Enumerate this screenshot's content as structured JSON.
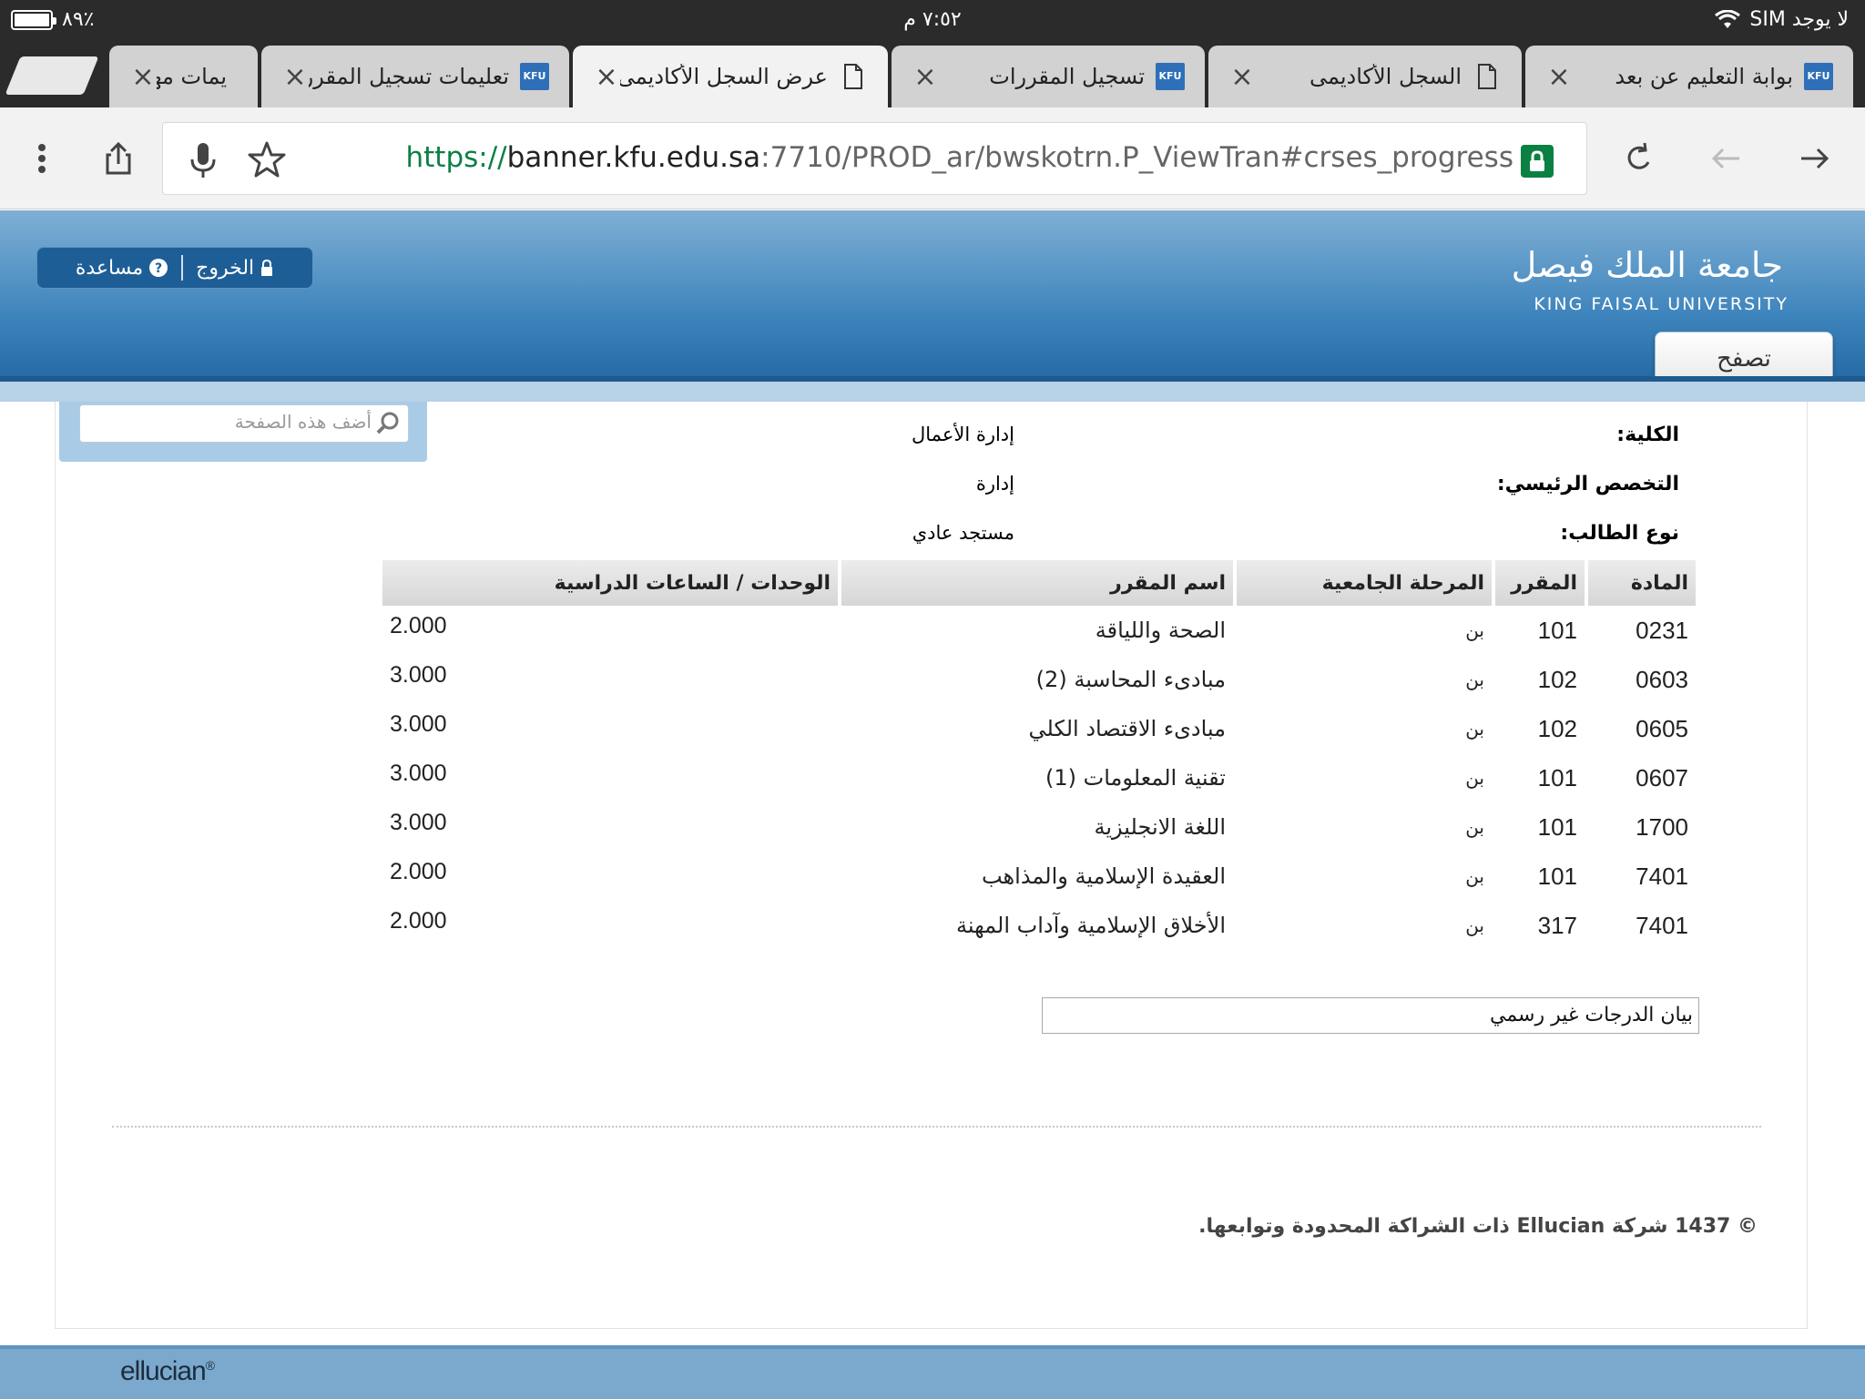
{
  "status_bar": {
    "battery_percent": 89,
    "battery_text": "٨٩٪",
    "time": "٧:٥٢ م",
    "carrier": "لا يوجد SIM"
  },
  "tabs": [
    {
      "title": "بوابة التعليم عن بعد",
      "icon": "kfu-logo",
      "active": false
    },
    {
      "title": "السجل الأكاديمى",
      "icon": "document-icon",
      "active": false
    },
    {
      "title": "تسجيل المقررات",
      "icon": "kfu-logo",
      "active": false
    },
    {
      "title": "عرض السجل الأكاديمى",
      "icon": "document-icon",
      "active": true
    },
    {
      "title": "تعليمات تسجيل المقررا",
      "icon": "kfu-logo",
      "active": false
    },
    {
      "title": "يمات مهـ",
      "icon": "",
      "active": false
    }
  ],
  "tab_logo_text": "KFU",
  "omnibox": {
    "scheme": "https://",
    "host": "banner.kfu.edu.sa",
    "path": ":7710/PROD_ar/bwskotrn.P_ViewTran#crses_progress"
  },
  "header": {
    "brand_ar": "جامعة الملك فيصل",
    "brand_en": "KING FAISAL UNIVERSITY",
    "logout_label": "الخروج",
    "help_label": "مساعدة",
    "browse_label": "تصفح"
  },
  "search": {
    "placeholder": "أضف هذه الصفحة"
  },
  "student_info": [
    {
      "label": "الكلية:",
      "value": "إدارة الأعمال"
    },
    {
      "label": "التخصص الرئيسي:",
      "value": "إدارة"
    },
    {
      "label": "نوع الطالب:",
      "value": "مستجد عادي"
    }
  ],
  "courses_table": {
    "headers": [
      "المادة",
      "المقرر",
      "المرحلة الجامعية",
      "اسم المقرر",
      "الوحدات / الساعات الدراسية"
    ],
    "rows": [
      {
        "subject": "0231",
        "course": "101",
        "level": "بن",
        "title": "الصحة واللياقة",
        "units": "2.000"
      },
      {
        "subject": "0603",
        "course": "102",
        "level": "بن",
        "title": "مبادىء المحاسبة (2)",
        "units": "3.000"
      },
      {
        "subject": "0605",
        "course": "102",
        "level": "بن",
        "title": "مبادىء الاقتصاد الكلي",
        "units": "3.000"
      },
      {
        "subject": "0607",
        "course": "101",
        "level": "بن",
        "title": "تقنية المعلومات (1)",
        "units": "3.000"
      },
      {
        "subject": "1700",
        "course": "101",
        "level": "بن",
        "title": "اللغة الانجليزية",
        "units": "3.000"
      },
      {
        "subject": "7401",
        "course": "101",
        "level": "بن",
        "title": "العقيدة الإسلامية والمذاهب",
        "units": "2.000"
      },
      {
        "subject": "7401",
        "course": "317",
        "level": "بن",
        "title": "الأخلاق الإسلامية وآداب المهنة",
        "units": "2.000"
      }
    ]
  },
  "transcript_type": "بيان الدرجات غير رسمي",
  "copyright": "© 1437 شركة Ellucian ذات الشراكة المحدودة وتوابعها.",
  "footer": {
    "logo": "ellucian",
    "logo_mark": "®"
  },
  "colors": {
    "header_top": "#7fb0d4",
    "header_bottom": "#2469a3",
    "secure_green": "#0b8043",
    "table_header": "#d6d6d6"
  }
}
